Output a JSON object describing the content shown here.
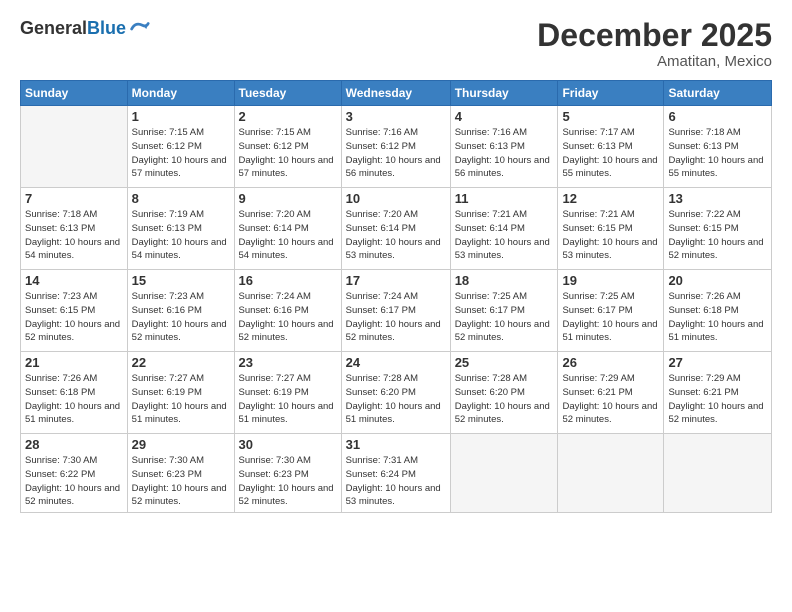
{
  "logo": {
    "general": "General",
    "blue": "Blue"
  },
  "header": {
    "month": "December 2025",
    "location": "Amatitan, Mexico"
  },
  "days_of_week": [
    "Sunday",
    "Monday",
    "Tuesday",
    "Wednesday",
    "Thursday",
    "Friday",
    "Saturday"
  ],
  "weeks": [
    [
      {
        "day": "",
        "sunrise": "",
        "sunset": "",
        "daylight": ""
      },
      {
        "day": "1",
        "sunrise": "Sunrise: 7:15 AM",
        "sunset": "Sunset: 6:12 PM",
        "daylight": "Daylight: 10 hours and 57 minutes."
      },
      {
        "day": "2",
        "sunrise": "Sunrise: 7:15 AM",
        "sunset": "Sunset: 6:12 PM",
        "daylight": "Daylight: 10 hours and 57 minutes."
      },
      {
        "day": "3",
        "sunrise": "Sunrise: 7:16 AM",
        "sunset": "Sunset: 6:12 PM",
        "daylight": "Daylight: 10 hours and 56 minutes."
      },
      {
        "day": "4",
        "sunrise": "Sunrise: 7:16 AM",
        "sunset": "Sunset: 6:13 PM",
        "daylight": "Daylight: 10 hours and 56 minutes."
      },
      {
        "day": "5",
        "sunrise": "Sunrise: 7:17 AM",
        "sunset": "Sunset: 6:13 PM",
        "daylight": "Daylight: 10 hours and 55 minutes."
      },
      {
        "day": "6",
        "sunrise": "Sunrise: 7:18 AM",
        "sunset": "Sunset: 6:13 PM",
        "daylight": "Daylight: 10 hours and 55 minutes."
      }
    ],
    [
      {
        "day": "7",
        "sunrise": "Sunrise: 7:18 AM",
        "sunset": "Sunset: 6:13 PM",
        "daylight": "Daylight: 10 hours and 54 minutes."
      },
      {
        "day": "8",
        "sunrise": "Sunrise: 7:19 AM",
        "sunset": "Sunset: 6:13 PM",
        "daylight": "Daylight: 10 hours and 54 minutes."
      },
      {
        "day": "9",
        "sunrise": "Sunrise: 7:20 AM",
        "sunset": "Sunset: 6:14 PM",
        "daylight": "Daylight: 10 hours and 54 minutes."
      },
      {
        "day": "10",
        "sunrise": "Sunrise: 7:20 AM",
        "sunset": "Sunset: 6:14 PM",
        "daylight": "Daylight: 10 hours and 53 minutes."
      },
      {
        "day": "11",
        "sunrise": "Sunrise: 7:21 AM",
        "sunset": "Sunset: 6:14 PM",
        "daylight": "Daylight: 10 hours and 53 minutes."
      },
      {
        "day": "12",
        "sunrise": "Sunrise: 7:21 AM",
        "sunset": "Sunset: 6:15 PM",
        "daylight": "Daylight: 10 hours and 53 minutes."
      },
      {
        "day": "13",
        "sunrise": "Sunrise: 7:22 AM",
        "sunset": "Sunset: 6:15 PM",
        "daylight": "Daylight: 10 hours and 52 minutes."
      }
    ],
    [
      {
        "day": "14",
        "sunrise": "Sunrise: 7:23 AM",
        "sunset": "Sunset: 6:15 PM",
        "daylight": "Daylight: 10 hours and 52 minutes."
      },
      {
        "day": "15",
        "sunrise": "Sunrise: 7:23 AM",
        "sunset": "Sunset: 6:16 PM",
        "daylight": "Daylight: 10 hours and 52 minutes."
      },
      {
        "day": "16",
        "sunrise": "Sunrise: 7:24 AM",
        "sunset": "Sunset: 6:16 PM",
        "daylight": "Daylight: 10 hours and 52 minutes."
      },
      {
        "day": "17",
        "sunrise": "Sunrise: 7:24 AM",
        "sunset": "Sunset: 6:17 PM",
        "daylight": "Daylight: 10 hours and 52 minutes."
      },
      {
        "day": "18",
        "sunrise": "Sunrise: 7:25 AM",
        "sunset": "Sunset: 6:17 PM",
        "daylight": "Daylight: 10 hours and 52 minutes."
      },
      {
        "day": "19",
        "sunrise": "Sunrise: 7:25 AM",
        "sunset": "Sunset: 6:17 PM",
        "daylight": "Daylight: 10 hours and 51 minutes."
      },
      {
        "day": "20",
        "sunrise": "Sunrise: 7:26 AM",
        "sunset": "Sunset: 6:18 PM",
        "daylight": "Daylight: 10 hours and 51 minutes."
      }
    ],
    [
      {
        "day": "21",
        "sunrise": "Sunrise: 7:26 AM",
        "sunset": "Sunset: 6:18 PM",
        "daylight": "Daylight: 10 hours and 51 minutes."
      },
      {
        "day": "22",
        "sunrise": "Sunrise: 7:27 AM",
        "sunset": "Sunset: 6:19 PM",
        "daylight": "Daylight: 10 hours and 51 minutes."
      },
      {
        "day": "23",
        "sunrise": "Sunrise: 7:27 AM",
        "sunset": "Sunset: 6:19 PM",
        "daylight": "Daylight: 10 hours and 51 minutes."
      },
      {
        "day": "24",
        "sunrise": "Sunrise: 7:28 AM",
        "sunset": "Sunset: 6:20 PM",
        "daylight": "Daylight: 10 hours and 51 minutes."
      },
      {
        "day": "25",
        "sunrise": "Sunrise: 7:28 AM",
        "sunset": "Sunset: 6:20 PM",
        "daylight": "Daylight: 10 hours and 52 minutes."
      },
      {
        "day": "26",
        "sunrise": "Sunrise: 7:29 AM",
        "sunset": "Sunset: 6:21 PM",
        "daylight": "Daylight: 10 hours and 52 minutes."
      },
      {
        "day": "27",
        "sunrise": "Sunrise: 7:29 AM",
        "sunset": "Sunset: 6:21 PM",
        "daylight": "Daylight: 10 hours and 52 minutes."
      }
    ],
    [
      {
        "day": "28",
        "sunrise": "Sunrise: 7:30 AM",
        "sunset": "Sunset: 6:22 PM",
        "daylight": "Daylight: 10 hours and 52 minutes."
      },
      {
        "day": "29",
        "sunrise": "Sunrise: 7:30 AM",
        "sunset": "Sunset: 6:23 PM",
        "daylight": "Daylight: 10 hours and 52 minutes."
      },
      {
        "day": "30",
        "sunrise": "Sunrise: 7:30 AM",
        "sunset": "Sunset: 6:23 PM",
        "daylight": "Daylight: 10 hours and 52 minutes."
      },
      {
        "day": "31",
        "sunrise": "Sunrise: 7:31 AM",
        "sunset": "Sunset: 6:24 PM",
        "daylight": "Daylight: 10 hours and 53 minutes."
      },
      {
        "day": "",
        "sunrise": "",
        "sunset": "",
        "daylight": ""
      },
      {
        "day": "",
        "sunrise": "",
        "sunset": "",
        "daylight": ""
      },
      {
        "day": "",
        "sunrise": "",
        "sunset": "",
        "daylight": ""
      }
    ]
  ]
}
